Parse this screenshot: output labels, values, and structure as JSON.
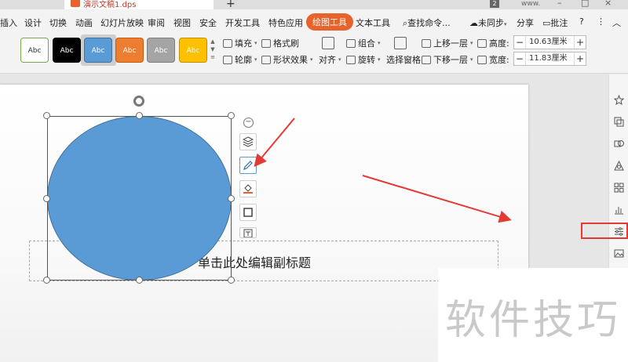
{
  "titlebar": {
    "doc_name": "演示文稿1.dps",
    "badge": "2",
    "user": "www."
  },
  "menu": {
    "items": [
      "插入",
      "设计",
      "切换",
      "动画",
      "幻灯片放映",
      "审阅",
      "视图",
      "安全",
      "开发工具",
      "特色应用",
      "绘图工具",
      "文本工具"
    ],
    "active": "绘图工具",
    "search": "查找命令...",
    "sync": "未同步",
    "share": "分享",
    "annotate": "批注",
    "help": "?"
  },
  "ribbon": {
    "styles": [
      {
        "label": "Abc",
        "bg": "#ffffff",
        "fg": "#333333",
        "border": "#7aa84f"
      },
      {
        "label": "Abc",
        "bg": "#000000",
        "fg": "#ffffff",
        "border": "#000000"
      },
      {
        "label": "Abc",
        "bg": "#5b9bd5",
        "fg": "#ffffff",
        "border": "#41719c"
      },
      {
        "label": "Abc",
        "bg": "#ed7d31",
        "fg": "#ffffff",
        "border": "#c55a11"
      },
      {
        "label": "Abc",
        "bg": "#a5a5a5",
        "fg": "#ffffff",
        "border": "#7f7f7f"
      },
      {
        "label": "Abc",
        "bg": "#ffc000",
        "fg": "#ffffff",
        "border": "#bf9000"
      }
    ],
    "fill": "填充",
    "format_painter": "格式刷",
    "outline": "轮廓",
    "shape_effects": "形状效果",
    "align": "对齐",
    "group": "组合",
    "rotate": "旋转",
    "selection_pane": "选择窗格",
    "bring_forward": "上移一层",
    "send_backward": "下移一层",
    "height_label": "高度:",
    "height_value": "10.63厘米",
    "width_label": "宽度:",
    "width_value": "11.83厘米"
  },
  "slide": {
    "subtitle_placeholder": "单击此处编辑副标题"
  },
  "watermark": "软件技巧",
  "colors": {
    "accent": "#e8632b",
    "shape_fill": "#5b9bd5",
    "arrow_red": "#e53935"
  }
}
